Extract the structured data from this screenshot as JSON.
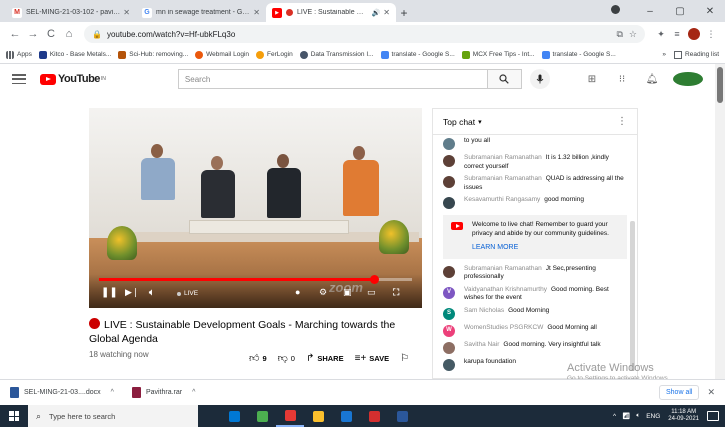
{
  "browser": {
    "tabs": [
      {
        "title": "SEL-MING-21-03-102 - pavithra...",
        "favicon_color": "#d93025",
        "favicon_glyph": "M",
        "active": false
      },
      {
        "title": "mn in sewage treatment - Googl...",
        "favicon_color": "#4285f4",
        "favicon_glyph": "G",
        "active": false
      },
      {
        "title": "LIVE : Sustainable Develo...",
        "favicon_color": "#ff0000",
        "favicon_glyph": "▶",
        "active": true
      }
    ],
    "new_tab_glyph": "+",
    "window_controls": {
      "minimize": "–",
      "maximize": "▢",
      "close": "✕"
    },
    "url": "youtube.com/watch?v=Hf-ubkFLq3o",
    "nav": {
      "back": "←",
      "forward": "→",
      "reload": "C",
      "home": "⌂"
    }
  },
  "bookmarks": [
    {
      "label": "Apps",
      "color": "#5f6368"
    },
    {
      "label": "Kitco - Base Metals...",
      "color": "#1e3a8a"
    },
    {
      "label": "Sci-Hub: removing...",
      "color": "#b45309"
    },
    {
      "label": "Webmail Login",
      "color": "#ea580c"
    },
    {
      "label": "FerLogin",
      "color": "#f59e0b"
    },
    {
      "label": "Data Transmission I...",
      "color": "#475569"
    },
    {
      "label": "translate - Google S...",
      "color": "#4285f4"
    },
    {
      "label": "MCX Free Tips - Int...",
      "color": "#65a30d"
    },
    {
      "label": "translate - Google S...",
      "color": "#4285f4"
    }
  ],
  "bookmarks_overflow": "»",
  "reading_list": "Reading list",
  "youtube": {
    "logo_text": "YouTube",
    "logo_region": "IN",
    "search_placeholder": "Search",
    "video": {
      "title": "LIVE : Sustainable Development Goals - Marching towards the Global Agenda",
      "watching": "18 watching now",
      "live_label": "LIVE",
      "progress": 0.88,
      "likes": "9",
      "dislikes": "0",
      "share_label": "SHARE",
      "save_label": "SAVE",
      "overlay_text": "zoom"
    },
    "chat": {
      "header": "Top chat",
      "messages": [
        {
          "author": "",
          "text": "to you all",
          "avatar_color": "#607d8b",
          "avatar_letter": ""
        },
        {
          "author": "Subramanian Ramanathan",
          "text": "It is 1.32 billion ,kindly correct yourself",
          "avatar_color": "#5d4037",
          "avatar_letter": ""
        },
        {
          "author": "Subramanian Ramanathan",
          "text": "QUAD is addressing all the issues",
          "avatar_color": "#5d4037",
          "avatar_letter": ""
        },
        {
          "author": "Kesavamurthi Rangasamy",
          "text": "good morning",
          "avatar_color": "#37474f",
          "avatar_letter": ""
        }
      ],
      "notice": {
        "text": "Welcome to live chat! Remember to guard your privacy and abide by our community guidelines.",
        "link": "LEARN MORE"
      },
      "messages_after": [
        {
          "author": "Subramanian Ramanathan",
          "text": "Jt Sec,presenting professionally",
          "avatar_color": "#5d4037",
          "avatar_letter": ""
        },
        {
          "author": "Vaidyanathan Krishnamurthy",
          "text": "Good morning. Best wishes for the event",
          "avatar_color": "#7e57c2",
          "avatar_letter": "V"
        },
        {
          "author": "Sam Nicholas",
          "text": "Good Morning",
          "avatar_color": "#00897b",
          "avatar_letter": "S"
        },
        {
          "author": "WomenStudies PSGRKCW",
          "text": "Good Morning all",
          "avatar_color": "#ec407a",
          "avatar_letter": "W"
        },
        {
          "author": "Savitha Nair",
          "text": "Good morning. Very insightful talk",
          "avatar_color": "#8d6e63",
          "avatar_letter": ""
        },
        {
          "author": "",
          "text": "karupa foundation",
          "avatar_color": "#455a64",
          "avatar_letter": ""
        }
      ]
    }
  },
  "activation": {
    "line1": "Activate Windows",
    "line2": "Go to Settings to activate Windows."
  },
  "downloads": [
    {
      "name": "SEL-MING-21-03....docx",
      "icon_color": "#2b579a"
    },
    {
      "name": "Pavithra.rar",
      "icon_color": "#8b1e3f"
    }
  ],
  "downloads_show_all": "Show all",
  "taskbar": {
    "search_placeholder": "Type here to search",
    "apps": [
      "#0078d4",
      "#4caf50",
      "#e53935",
      "#fbc02d",
      "#1976d2",
      "#d32f2f",
      "#2b579a"
    ],
    "tray": {
      "lang": "ENG",
      "time": "11:18 AM",
      "date": "24-09-2021"
    }
  }
}
